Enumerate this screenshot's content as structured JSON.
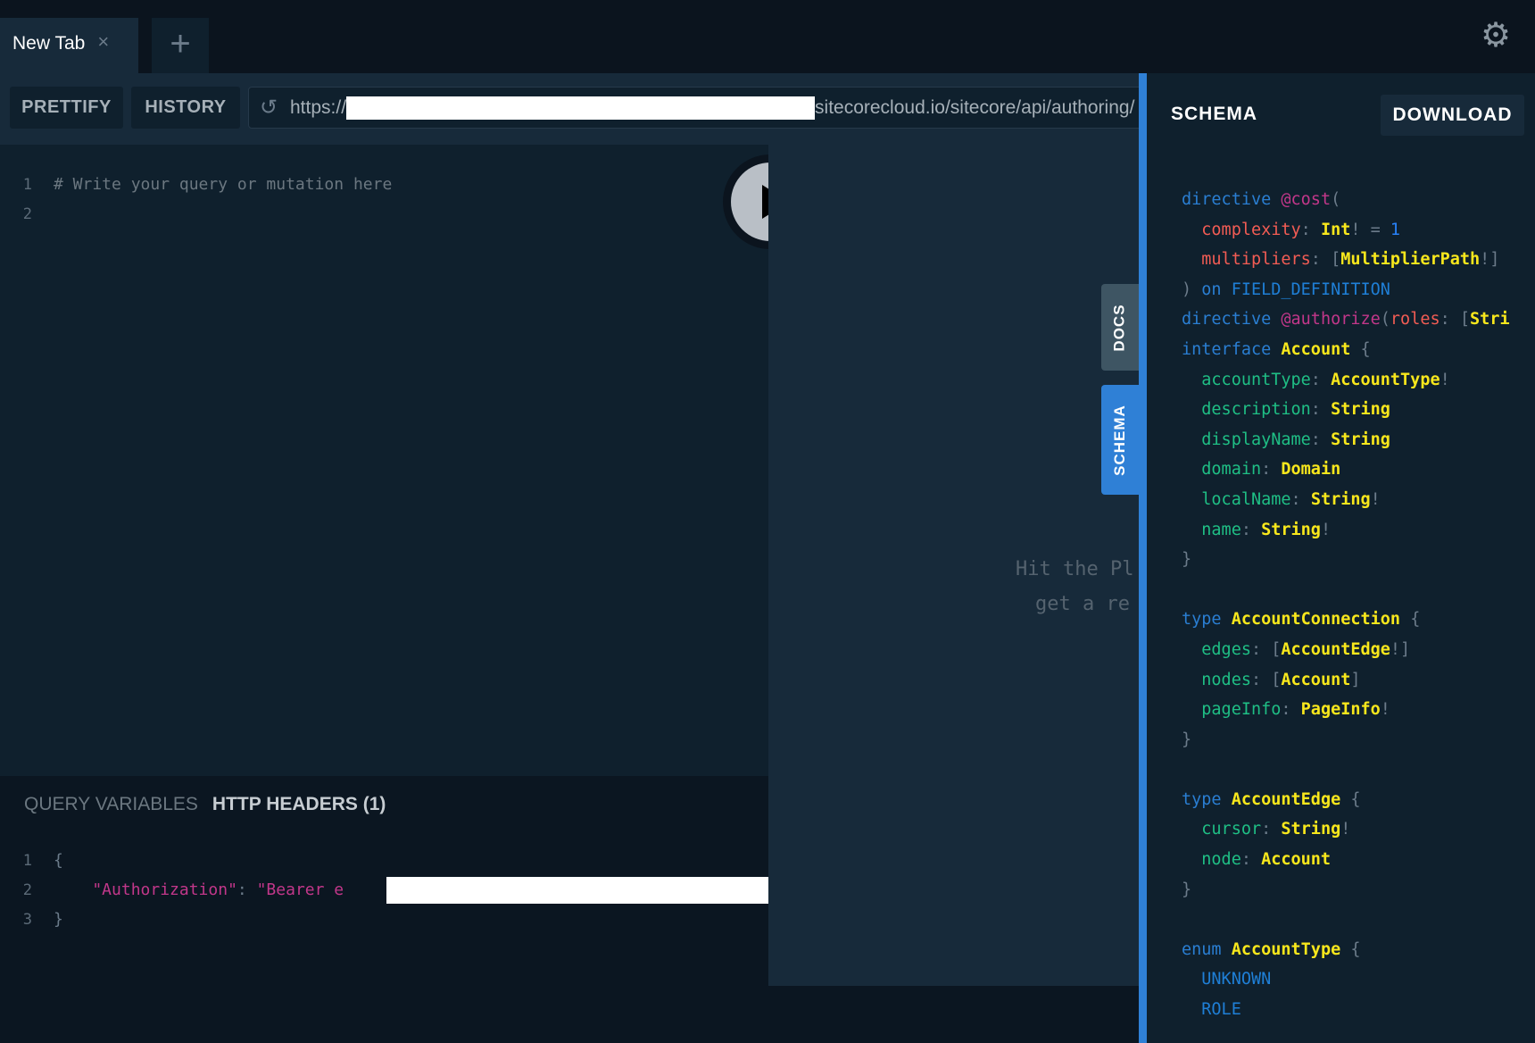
{
  "tabs": {
    "active": "New Tab",
    "close_icon": "×",
    "add_icon": "+"
  },
  "settings_icon": "⚙",
  "toolbar": {
    "prettify": "PRETTIFY",
    "history": "HISTORY",
    "url_prefix": "https://",
    "url_suffix": "sitecorecloud.io/sitecore/api/authoring/",
    "reload_icon": "↺"
  },
  "editor": {
    "lines": [
      {
        "n": "1",
        "text": "# Write your query or mutation here"
      },
      {
        "n": "2",
        "text": ""
      }
    ]
  },
  "results": {
    "placeholder_line1": "Hit the Pl",
    "placeholder_line2": "get a re"
  },
  "side_tabs": {
    "docs": "DOCS",
    "schema": "SCHEMA"
  },
  "variables": {
    "tab_query": "QUERY VARIABLES",
    "tab_headers": "HTTP HEADERS (1)",
    "lines": [
      {
        "n": "1",
        "tokens": [
          [
            "pun",
            "{"
          ]
        ]
      },
      {
        "n": "2",
        "tokens": [
          [
            "dir",
            "    \"Authorization\""
          ],
          [
            "pun",
            ": "
          ],
          [
            "dir",
            "\"Bearer e"
          ]
        ]
      },
      {
        "n": "3",
        "tokens": [
          [
            "pun",
            "}"
          ]
        ]
      }
    ]
  },
  "schema": {
    "title": "SCHEMA",
    "download": "DOWNLOAD",
    "lines": [
      [
        [
          "kw",
          "directive "
        ],
        [
          "dir",
          "@cost"
        ],
        [
          "pun",
          "("
        ]
      ],
      [
        [
          "arg",
          "  complexity"
        ],
        [
          "pun",
          ": "
        ],
        [
          "typ",
          "Int"
        ],
        [
          "pun",
          "! = "
        ],
        [
          "num",
          "1"
        ]
      ],
      [
        [
          "arg",
          "  multipliers"
        ],
        [
          "pun",
          ": ["
        ],
        [
          "typ",
          "MultiplierPath"
        ],
        [
          "pun",
          "!]"
        ]
      ],
      [
        [
          "pun",
          ") "
        ],
        [
          "kw",
          "on "
        ],
        [
          "enm",
          "FIELD_DEFINITION"
        ]
      ],
      [
        [
          "kw",
          "directive "
        ],
        [
          "dir",
          "@authorize"
        ],
        [
          "pun",
          "("
        ],
        [
          "arg",
          "roles"
        ],
        [
          "pun",
          ": ["
        ],
        [
          "typ",
          "Stri"
        ]
      ],
      [
        [
          "kw",
          "interface "
        ],
        [
          "typ",
          "Account"
        ],
        [
          "pun",
          " {"
        ]
      ],
      [
        [
          "fld",
          "  accountType"
        ],
        [
          "pun",
          ": "
        ],
        [
          "typ",
          "AccountType"
        ],
        [
          "pun",
          "!"
        ]
      ],
      [
        [
          "fld",
          "  description"
        ],
        [
          "pun",
          ": "
        ],
        [
          "typ",
          "String"
        ]
      ],
      [
        [
          "fld",
          "  displayName"
        ],
        [
          "pun",
          ": "
        ],
        [
          "typ",
          "String"
        ]
      ],
      [
        [
          "fld",
          "  domain"
        ],
        [
          "pun",
          ": "
        ],
        [
          "typ",
          "Domain"
        ]
      ],
      [
        [
          "fld",
          "  localName"
        ],
        [
          "pun",
          ": "
        ],
        [
          "typ",
          "String"
        ],
        [
          "pun",
          "!"
        ]
      ],
      [
        [
          "fld",
          "  name"
        ],
        [
          "pun",
          ": "
        ],
        [
          "typ",
          "String"
        ],
        [
          "pun",
          "!"
        ]
      ],
      [
        [
          "pun",
          "}"
        ]
      ],
      [],
      [
        [
          "kw",
          "type "
        ],
        [
          "typ",
          "AccountConnection"
        ],
        [
          "pun",
          " {"
        ]
      ],
      [
        [
          "fld",
          "  edges"
        ],
        [
          "pun",
          ": ["
        ],
        [
          "typ",
          "AccountEdge"
        ],
        [
          "pun",
          "!]"
        ]
      ],
      [
        [
          "fld",
          "  nodes"
        ],
        [
          "pun",
          ": ["
        ],
        [
          "typ",
          "Account"
        ],
        [
          "pun",
          "]"
        ]
      ],
      [
        [
          "fld",
          "  pageInfo"
        ],
        [
          "pun",
          ": "
        ],
        [
          "typ",
          "PageInfo"
        ],
        [
          "pun",
          "!"
        ]
      ],
      [
        [
          "pun",
          "}"
        ]
      ],
      [],
      [
        [
          "kw",
          "type "
        ],
        [
          "typ",
          "AccountEdge"
        ],
        [
          "pun",
          " {"
        ]
      ],
      [
        [
          "fld",
          "  cursor"
        ],
        [
          "pun",
          ": "
        ],
        [
          "typ",
          "String"
        ],
        [
          "pun",
          "!"
        ]
      ],
      [
        [
          "fld",
          "  node"
        ],
        [
          "pun",
          ": "
        ],
        [
          "typ",
          "Account"
        ]
      ],
      [
        [
          "pun",
          "}"
        ]
      ],
      [],
      [
        [
          "kw",
          "enum "
        ],
        [
          "typ",
          "AccountType"
        ],
        [
          "pun",
          " {"
        ]
      ],
      [
        [
          "enm",
          "  UNKNOWN"
        ]
      ],
      [
        [
          "enm",
          "  ROLE"
        ]
      ]
    ]
  },
  "colors": {
    "accent": "#2f80d6",
    "background": "#0b141e",
    "panel": "#172a3a",
    "editor": "#0f202d"
  }
}
